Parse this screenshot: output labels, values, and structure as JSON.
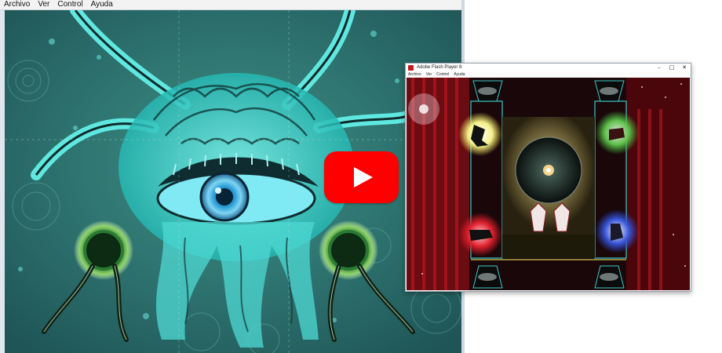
{
  "left_window": {
    "menu": [
      "Archivo",
      "Ver",
      "Control",
      "Ayuda"
    ]
  },
  "overlay": {
    "icon": "youtube-play-icon",
    "accent_color": "#ff0000"
  },
  "small_window": {
    "title": "Adobe Flash Player 8",
    "menu": [
      "Archivo",
      "Ver",
      "Control",
      "Ayuda"
    ],
    "controls": [
      "–",
      "□",
      "✕"
    ]
  }
}
